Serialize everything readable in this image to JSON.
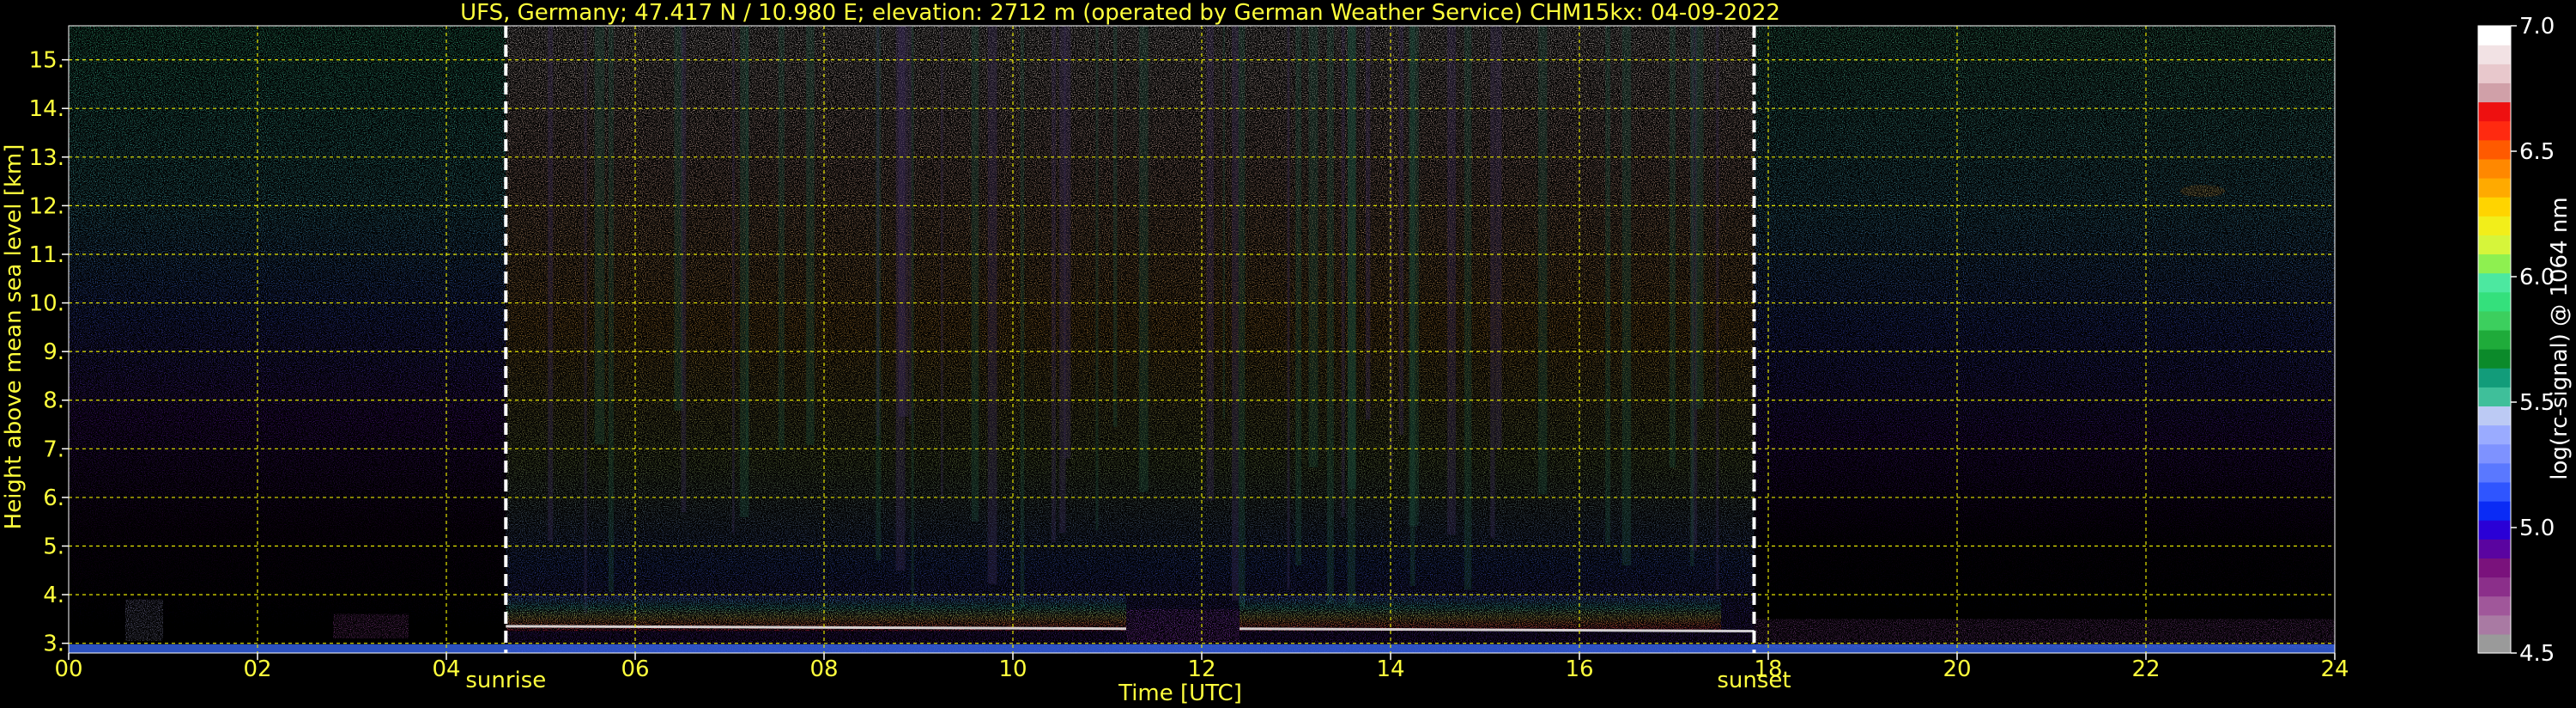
{
  "chart_data": {
    "type": "heatmap",
    "title": "UFS, Germany; 47.417 N / 10.980 E; elevation: 2712 m  (operated by German Weather Service)    CHM15kx: 04-09-2022",
    "xlabel": "Time [UTC]",
    "ylabel": "Height above mean sea level [km]",
    "xlim": [
      0,
      24
    ],
    "ylim": [
      2.8,
      15.7
    ],
    "xticks": [
      0,
      2,
      4,
      6,
      8,
      10,
      12,
      14,
      16,
      18,
      20,
      22,
      24
    ],
    "xtick_labels": [
      "00",
      "02",
      "04",
      "06",
      "08",
      "10",
      "12",
      "14",
      "16",
      "18",
      "20",
      "22",
      "24"
    ],
    "yticks": [
      3,
      4,
      5,
      6,
      7,
      8,
      9,
      10,
      11,
      12,
      13,
      14,
      15
    ],
    "ytick_labels": [
      "3.",
      "4.",
      "5.",
      "6.",
      "7.",
      "8.",
      "9.",
      "10.",
      "11.",
      "12.",
      "13.",
      "14.",
      "15."
    ],
    "grid": true,
    "markers": [
      {
        "label": "sunrise",
        "x": 4.63
      },
      {
        "label": "sunset",
        "x": 17.85
      }
    ],
    "colorbar": {
      "label": "log(rc-signal) @ 1064 nm",
      "min": 4.5,
      "max": 7.0,
      "ticks": [
        4.5,
        5.0,
        5.5,
        6.0,
        6.5,
        7.0
      ],
      "tick_labels": [
        "4.5",
        "5.0",
        "5.5",
        "6.0",
        "6.5",
        "7.0"
      ],
      "colors": [
        "#9a9a9a",
        "#a97aa3",
        "#a0579a",
        "#8b2f8a",
        "#7a127c",
        "#5a04a0",
        "#2a00d6",
        "#0a2bf5",
        "#2f55ff",
        "#5a78ff",
        "#7e92ff",
        "#9aabff",
        "#bccaf4",
        "#3fbf9a",
        "#129c7a",
        "#0b8a2a",
        "#1fab3a",
        "#3ccf5e",
        "#34e07c",
        "#4ce8a0",
        "#8ef050",
        "#d6f53a",
        "#f2ee1a",
        "#ffd400",
        "#ffaa00",
        "#ff8800",
        "#ff5a00",
        "#ff2a10",
        "#ee1010",
        "#d0a0a8",
        "#e8c8cc",
        "#f2e2e4",
        "#ffffff"
      ]
    }
  }
}
